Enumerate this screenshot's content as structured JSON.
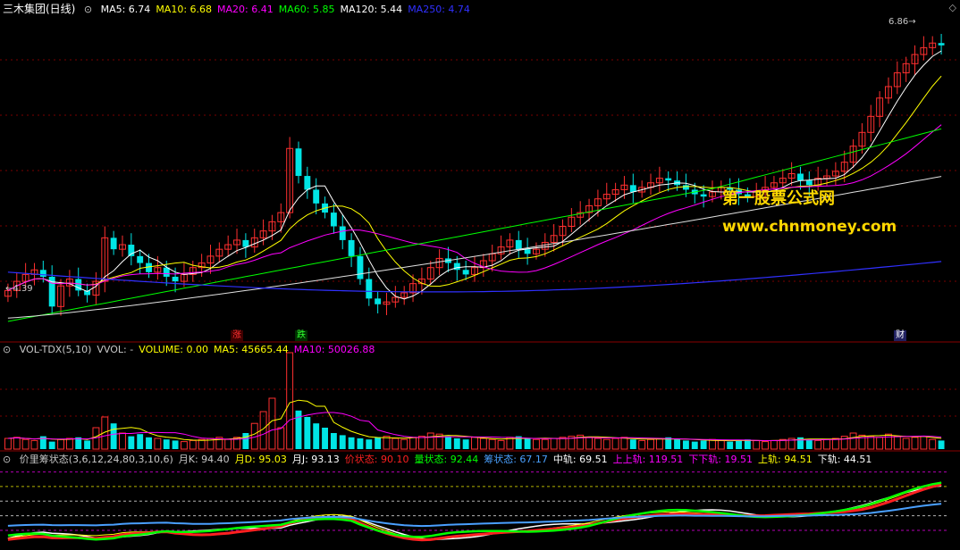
{
  "price_panel": {
    "title": "三木集团(日线)",
    "ma_labels": [
      {
        "text": "MA5: 6.74",
        "color": "#ffffff"
      },
      {
        "text": "MA10: 6.68",
        "color": "#ffff00"
      },
      {
        "text": "MA20: 6.41",
        "color": "#ff00ff"
      },
      {
        "text": "MA60: 5.85",
        "color": "#00ff00"
      },
      {
        "text": "MA120: 5.44",
        "color": "#ffffff"
      },
      {
        "text": "MA250: 4.74",
        "color": "#3030ff"
      }
    ],
    "low_label": "4.39",
    "high_label": "6.86",
    "markers": [
      {
        "text": "涨",
        "color": "#ff3030"
      },
      {
        "text": "跌",
        "color": "#30ff30"
      },
      {
        "text": "财",
        "color": "#ffffff"
      }
    ]
  },
  "watermark": {
    "title": "第一股票公式网",
    "url": "www.chnmoney.com"
  },
  "volume_panel": {
    "labels": [
      {
        "text": "VOL-TDX(5,10)",
        "color": "#c8c8c8"
      },
      {
        "text": "VVOL: -",
        "color": "#c8c8c8"
      },
      {
        "text": "VOLUME: 0.00",
        "color": "#ffff00"
      },
      {
        "text": "MA5: 45665.44",
        "color": "#ffff00"
      },
      {
        "text": "MA10: 50026.88",
        "color": "#ff00ff"
      }
    ]
  },
  "indicator_panel": {
    "labels": [
      {
        "text": "价里筹状态(3,6,12,24,80,3,10,6)",
        "color": "#c8c8c8"
      },
      {
        "text": "月K: 94.40",
        "color": "#c8c8c8"
      },
      {
        "text": "月D: 95.03",
        "color": "#ffff00"
      },
      {
        "text": "月J: 93.13",
        "color": "#ffffff"
      },
      {
        "text": "价状态: 90.10",
        "color": "#ff2020"
      },
      {
        "text": "量状态: 92.44",
        "color": "#00ff00"
      },
      {
        "text": "筹状态: 67.17",
        "color": "#4aa0ff"
      },
      {
        "text": "中轨: 69.51",
        "color": "#ffffff"
      },
      {
        "text": "上上轨: 119.51",
        "color": "#ff00ff"
      },
      {
        "text": "下下轨: 19.51",
        "color": "#ff00ff"
      },
      {
        "text": "上轨: 94.51",
        "color": "#ffff00"
      },
      {
        "text": "下轨: 44.51",
        "color": "#ffffff"
      }
    ]
  },
  "colors": {
    "up": "#ff3030",
    "down": "#00e5e5",
    "grid": "#7a0000"
  },
  "chart_data": {
    "type": "candlestick",
    "note_ma": "MA lines shown: MA5, MA10, MA20, MA60, MA120, MA250",
    "price_range": [
      4.39,
      6.86
    ],
    "closes": [
      4.62,
      4.7,
      4.76,
      4.8,
      4.74,
      4.48,
      4.66,
      4.72,
      4.62,
      4.58,
      4.7,
      5.08,
      4.98,
      5.02,
      4.92,
      4.86,
      4.78,
      4.82,
      4.74,
      4.7,
      4.76,
      4.82,
      4.86,
      4.92,
      4.98,
      5.02,
      5.06,
      5.0,
      5.08,
      5.14,
      5.22,
      5.3,
      5.86,
      5.62,
      5.5,
      5.38,
      5.3,
      5.18,
      5.06,
      4.92,
      4.72,
      4.55,
      4.5,
      4.52,
      4.56,
      4.6,
      4.68,
      4.72,
      4.82,
      4.9,
      4.86,
      4.8,
      4.76,
      4.82,
      4.88,
      4.94,
      5.0,
      5.06,
      4.98,
      4.94,
      4.98,
      5.04,
      5.1,
      5.18,
      5.26,
      5.3,
      5.36,
      5.42,
      5.46,
      5.5,
      5.54,
      5.48,
      5.52,
      5.56,
      5.6,
      5.58,
      5.54,
      5.5,
      5.46,
      5.44,
      5.48,
      5.52,
      5.5,
      5.46,
      5.44,
      5.48,
      5.52,
      5.56,
      5.6,
      5.64,
      5.58,
      5.54,
      5.6,
      5.62,
      5.66,
      5.74,
      5.88,
      6.0,
      6.14,
      6.3,
      6.4,
      6.52,
      6.6,
      6.68,
      6.74,
      6.78,
      6.76
    ],
    "volumes": [
      20,
      22,
      18,
      16,
      24,
      14,
      18,
      20,
      22,
      16,
      40,
      60,
      48,
      30,
      24,
      28,
      22,
      20,
      18,
      16,
      14,
      16,
      18,
      20,
      22,
      18,
      22,
      30,
      48,
      70,
      95,
      40,
      180,
      72,
      60,
      48,
      40,
      30,
      26,
      22,
      20,
      18,
      22,
      24,
      20,
      18,
      22,
      24,
      30,
      28,
      24,
      20,
      18,
      22,
      20,
      18,
      16,
      22,
      24,
      20,
      18,
      18,
      20,
      22,
      24,
      26,
      22,
      20,
      18,
      20,
      22,
      18,
      16,
      18,
      20,
      22,
      18,
      16,
      14,
      16,
      18,
      16,
      14,
      16,
      18,
      16,
      14,
      16,
      18,
      20,
      22,
      18,
      16,
      18,
      20,
      24,
      30,
      26,
      24,
      22,
      28,
      24,
      20,
      22,
      24,
      18,
      16
    ],
    "indicator_series": [
      "月K",
      "月D",
      "月J",
      "价状态",
      "量状态",
      "筹状态"
    ],
    "indicator_bands": {
      "中轨": 69.51,
      "上上轨": 119.51,
      "下下轨": 19.51,
      "上轨": 94.51,
      "下轨": 44.51
    }
  }
}
